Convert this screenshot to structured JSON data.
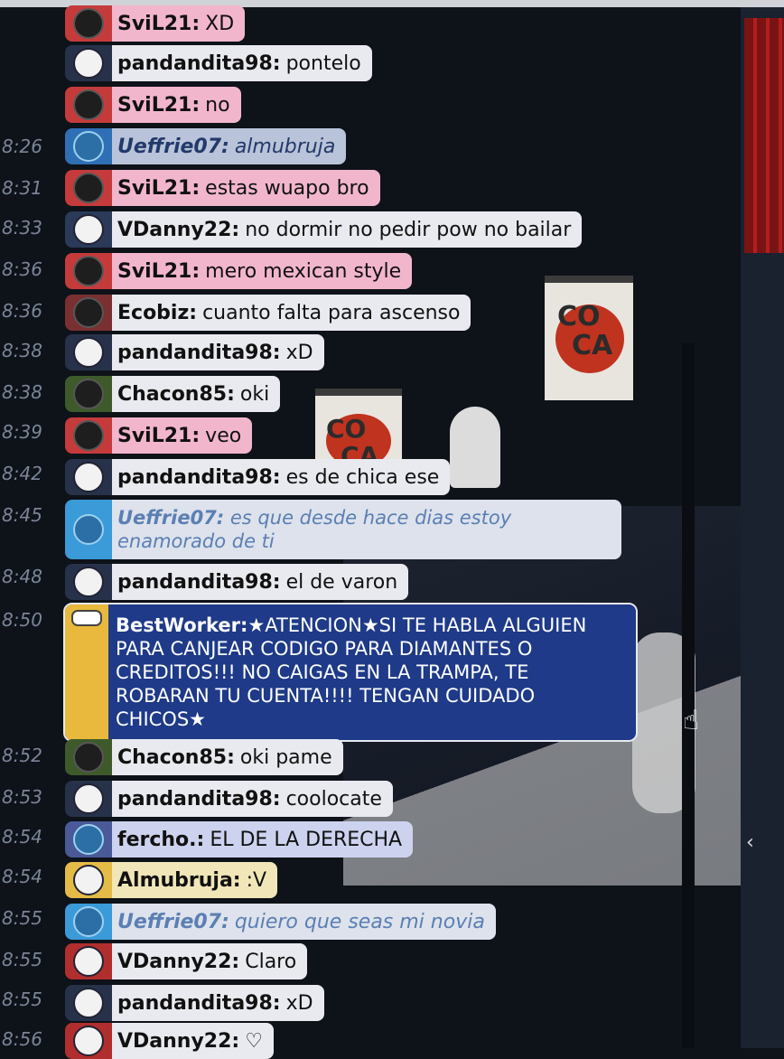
{
  "chat": {
    "messages": [
      {
        "time": "",
        "user": "SviL21:",
        "text": "XD"
      },
      {
        "time": "",
        "user": "pandandita98:",
        "text": "pontelo"
      },
      {
        "time": "",
        "user": "SviL21:",
        "text": "no"
      },
      {
        "time": "8:26",
        "user": "Ueffrie07:",
        "text": "almubruja"
      },
      {
        "time": "8:31",
        "user": "SviL21:",
        "text": "estas wuapo bro"
      },
      {
        "time": "8:33",
        "user": "VDanny22:",
        "text": "no dormir no pedir pow no bailar"
      },
      {
        "time": "8:36",
        "user": "SviL21:",
        "text": "mero mexican style"
      },
      {
        "time": "8:36",
        "user": "Ecobiz:",
        "text": "cuanto falta para ascenso"
      },
      {
        "time": "8:38",
        "user": "pandandita98:",
        "text": "xD"
      },
      {
        "time": "8:38",
        "user": "Chacon85:",
        "text": "oki"
      },
      {
        "time": "8:39",
        "user": "SviL21:",
        "text": "veo"
      },
      {
        "time": "8:42",
        "user": "pandandita98:",
        "text": "es de chica ese"
      },
      {
        "time": "8:45",
        "user": "Ueffrie07:",
        "text": "es que desde hace dias estoy enamorado de ti"
      },
      {
        "time": "8:48",
        "user": "pandandita98:",
        "text": "el de varon"
      },
      {
        "time": "8:50",
        "user": "BestWorker:",
        "text": "★ATENCION★SI TE HABLA ALGUIEN PARA CANJEAR CODIGO PARA DIAMANTES O CREDITOS!!! NO CAIGAS EN LA TRAMPA, TE ROBARAN TU CUENTA!!!! TENGAN CUIDADO CHICOS★"
      },
      {
        "time": "8:52",
        "user": "Chacon85:",
        "text": "oki pame"
      },
      {
        "time": "8:53",
        "user": "pandandita98:",
        "text": "coolocate"
      },
      {
        "time": "8:54",
        "user": "fercho.:",
        "text": "EL DE LA DERECHA"
      },
      {
        "time": "8:54",
        "user": "Almubruja:",
        "text": ":V"
      },
      {
        "time": "8:55",
        "user": "Ueffrie07:",
        "text": "quiero que seas mi novia"
      },
      {
        "time": "8:55",
        "user": "VDanny22:",
        "text": "Claro"
      },
      {
        "time": "8:55",
        "user": "pandandita98:",
        "text": "xD"
      },
      {
        "time": "8:56",
        "user": "VDanny22:",
        "text": "♡"
      }
    ]
  },
  "room": {
    "banner_letters": [
      "CO",
      "CA"
    ]
  },
  "icons": {
    "cursor": "hand-cursor-icon",
    "collapse": "chevron-left-icon"
  },
  "colors": {
    "staff_bubble": "#1e3a88",
    "staff_badge": "#e8b93c",
    "pink_bubble": "#f2b6cc"
  }
}
